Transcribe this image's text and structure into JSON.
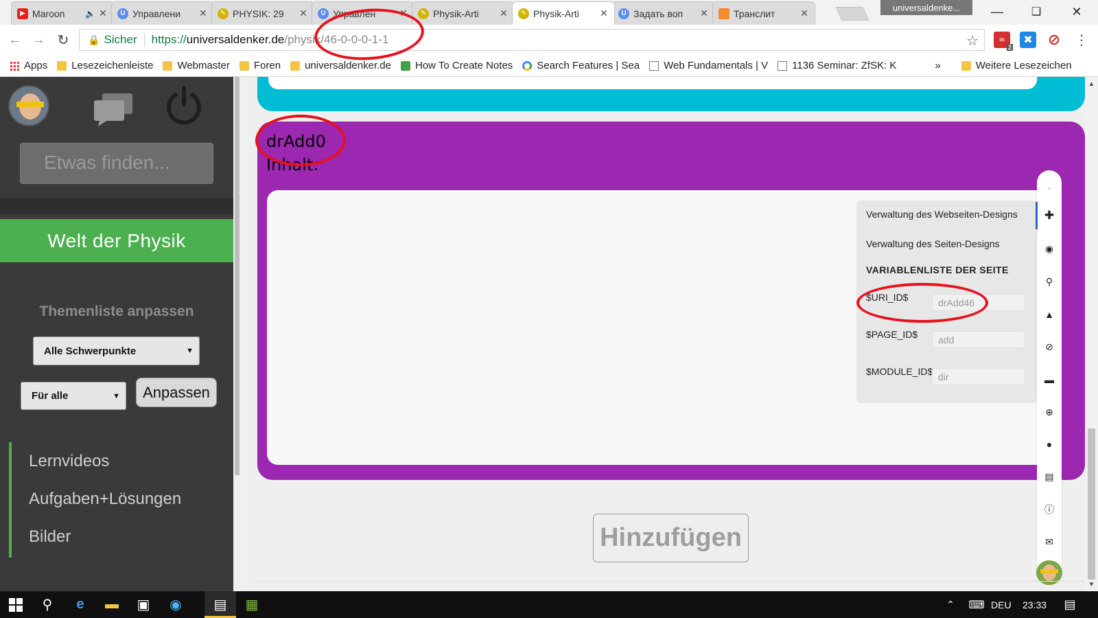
{
  "browser": {
    "tabs": [
      {
        "title": "Maroon",
        "icon": "youtube-icon",
        "color": "#e62117",
        "audio": true
      },
      {
        "title": "Управлени",
        "icon": "u-icon",
        "color": "#5b8def"
      },
      {
        "title": "PHYSIK: 29",
        "icon": "physik-icon",
        "color": "#d4b300"
      },
      {
        "title": "Управлен",
        "icon": "u-icon",
        "color": "#5b8def"
      },
      {
        "title": "Physik-Arti",
        "icon": "physik-icon",
        "color": "#d4b300"
      },
      {
        "title": "Physik-Arti",
        "icon": "physik-icon",
        "color": "#d4b300",
        "active": true
      },
      {
        "title": "Задать воп",
        "icon": "u-icon",
        "color": "#5b8def"
      },
      {
        "title": "Транслит",
        "icon": "translit-icon",
        "color": "#f28a2e"
      }
    ],
    "profile_name": "universaldenke...",
    "address": {
      "secure_label": "Sicher",
      "url_scheme": "https://",
      "url_host": "universaldenker.de",
      "url_path": "/physik/46-0-0-0-1-1"
    },
    "extension_badge": "2",
    "bookmarks": [
      {
        "label": "Apps",
        "icon": "apps-icon"
      },
      {
        "label": "Lesezeichenleiste",
        "icon": "folder-icon"
      },
      {
        "label": "Webmaster",
        "icon": "folder-icon"
      },
      {
        "label": "Foren",
        "icon": "folder-icon"
      },
      {
        "label": "universaldenker.de",
        "icon": "folder-icon"
      },
      {
        "label": "How To Create Notes",
        "icon": "notes-icon"
      },
      {
        "label": "Search Features | Sea",
        "icon": "google-icon"
      },
      {
        "label": "Web Fundamentals | V",
        "icon": "page-icon"
      },
      {
        "label": "1136 Seminar: ZfSK: K",
        "icon": "page-icon"
      }
    ],
    "bookmarks_overflow": "»",
    "bookmarks_other": "Weitere Lesezeichen"
  },
  "sidebar": {
    "search_placeholder": "Etwas finden...",
    "section_title": "Welt der Physik",
    "topics_heading": "Themenliste anpassen",
    "focus_select": "Alle Schwerpunkte",
    "audience_select": "Für alle",
    "apply_button": "Anpassen",
    "nav_items": [
      "Lernvideos",
      "Aufgaben+Lösungen",
      "Bilder"
    ]
  },
  "main": {
    "module_name": "drAdd0",
    "content_label": "Inhalt:",
    "add_button": "Hinzufügen"
  },
  "panel": {
    "link_site_design": "Verwaltung des Webseiten-Designs",
    "link_page_design": "Verwaltung des Seiten-Designs",
    "vars_heading": "VARIABLENLISTE DER SEITE",
    "vars": [
      {
        "name": "$URI_ID$",
        "value": "drAdd46"
      },
      {
        "name": "$PAGE_ID$",
        "value": "add"
      },
      {
        "name": "$MODULE_ID$",
        "value": "dir"
      }
    ],
    "rail_icons": [
      "chevron-down-icon",
      "puzzle-icon",
      "eye-icon",
      "search-icon",
      "bell-icon",
      "block-icon",
      "folder-icon",
      "plus-circle-icon",
      "chat-icon",
      "note-icon",
      "info-icon",
      "mail-icon"
    ]
  },
  "taskbar": {
    "language": "DEU",
    "time": "23:33"
  },
  "colors": {
    "cyan_block": "#00bcd4",
    "purple_block": "#9c27b0",
    "sidebar_green": "#4caf50",
    "annotation_red": "#e8101c"
  }
}
